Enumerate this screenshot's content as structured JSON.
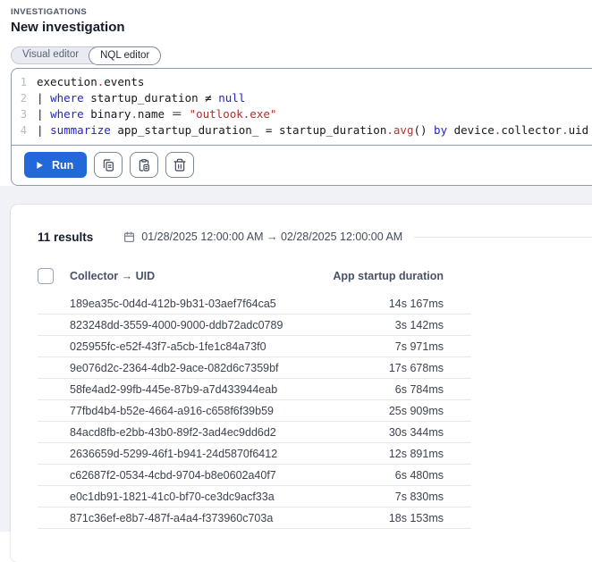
{
  "header": {
    "eyebrow": "INVESTIGATIONS",
    "title": "New investigation"
  },
  "tabs": {
    "visual": "Visual editor",
    "nql": "NQL editor",
    "active": "NQL editor"
  },
  "editor": {
    "lines": [
      {
        "num": "1",
        "tokens": [
          {
            "t": "execution",
            "c": "plain"
          },
          {
            "t": ".",
            "c": "accent"
          },
          {
            "t": "events",
            "c": "plain"
          }
        ]
      },
      {
        "num": "2",
        "tokens": [
          {
            "t": "| ",
            "c": "plain"
          },
          {
            "t": "where",
            "c": "kw"
          },
          {
            "t": " startup_duration ≠ ",
            "c": "plain"
          },
          {
            "t": "null",
            "c": "kw"
          }
        ]
      },
      {
        "num": "3",
        "tokens": [
          {
            "t": "| ",
            "c": "plain"
          },
          {
            "t": "where",
            "c": "kw"
          },
          {
            "t": " binary",
            "c": "plain"
          },
          {
            "t": ".",
            "c": "accent"
          },
          {
            "t": "name ＝ ",
            "c": "plain"
          },
          {
            "t": "\"outlook.exe\"",
            "c": "str"
          }
        ]
      },
      {
        "num": "4",
        "tokens": [
          {
            "t": "| ",
            "c": "plain"
          },
          {
            "t": "summarize",
            "c": "kw"
          },
          {
            "t": " app_startup_duration_ = startup_duration",
            "c": "plain"
          },
          {
            "t": ".",
            "c": "accent"
          },
          {
            "t": "avg",
            "c": "accent"
          },
          {
            "t": "() ",
            "c": "plain"
          },
          {
            "t": "by",
            "c": "kw"
          },
          {
            "t": " device",
            "c": "plain"
          },
          {
            "t": ".",
            "c": "accent"
          },
          {
            "t": "collector",
            "c": "plain"
          },
          {
            "t": ".",
            "c": "accent"
          },
          {
            "t": "uid",
            "c": "plain"
          }
        ]
      }
    ]
  },
  "toolbar": {
    "run_label": "Run",
    "icon_buttons": [
      "copy",
      "paste",
      "delete"
    ]
  },
  "results": {
    "count_label": "11 results",
    "date_range": "01/28/2025 12:00:00 AM → 02/28/2025 12:00:00 AM"
  },
  "table": {
    "columns": [
      "Collector → UID",
      "App startup duration"
    ],
    "rows": [
      {
        "uid": "189ea35c-0d4d-412b-9b31-03aef7f64ca5",
        "duration": "14s 167ms"
      },
      {
        "uid": "823248dd-3559-4000-9000-ddb72adc0789",
        "duration": "3s 142ms"
      },
      {
        "uid": "025955fc-e52f-43f7-a5cb-1fe1c84a73f0",
        "duration": "7s 971ms"
      },
      {
        "uid": "9e076d2c-2364-4db2-9ace-082d6c7359bf",
        "duration": "17s 678ms"
      },
      {
        "uid": "58fe4ad2-99fb-445e-87b9-a7d433944eab",
        "duration": "6s 784ms"
      },
      {
        "uid": "77fbd4b4-b52e-4664-a916-c658f6f39b59",
        "duration": "25s 909ms"
      },
      {
        "uid": "84acd8fb-e2bb-43b0-89f2-3ad4ec9dd6d2",
        "duration": "30s 344ms"
      },
      {
        "uid": "2636659d-5299-46f1-b941-24d5870f6412",
        "duration": "12s 891ms"
      },
      {
        "uid": "c62687f2-0534-4cbd-9704-b8e0602a40f7",
        "duration": "6s 480ms"
      },
      {
        "uid": "e0c1db91-1821-41c0-bf70-ce3dc9acf33a",
        "duration": "7s 830ms"
      },
      {
        "uid": "871c36ef-e8b7-487f-a4a4-f373960c703a",
        "duration": "18s 153ms"
      }
    ]
  },
  "colors": {
    "run_button": "#2368d9",
    "keyword": "#2323c8",
    "string": "#b02f2f",
    "accent_red": "#b5372f",
    "section_bg": "#f0f2f6"
  }
}
